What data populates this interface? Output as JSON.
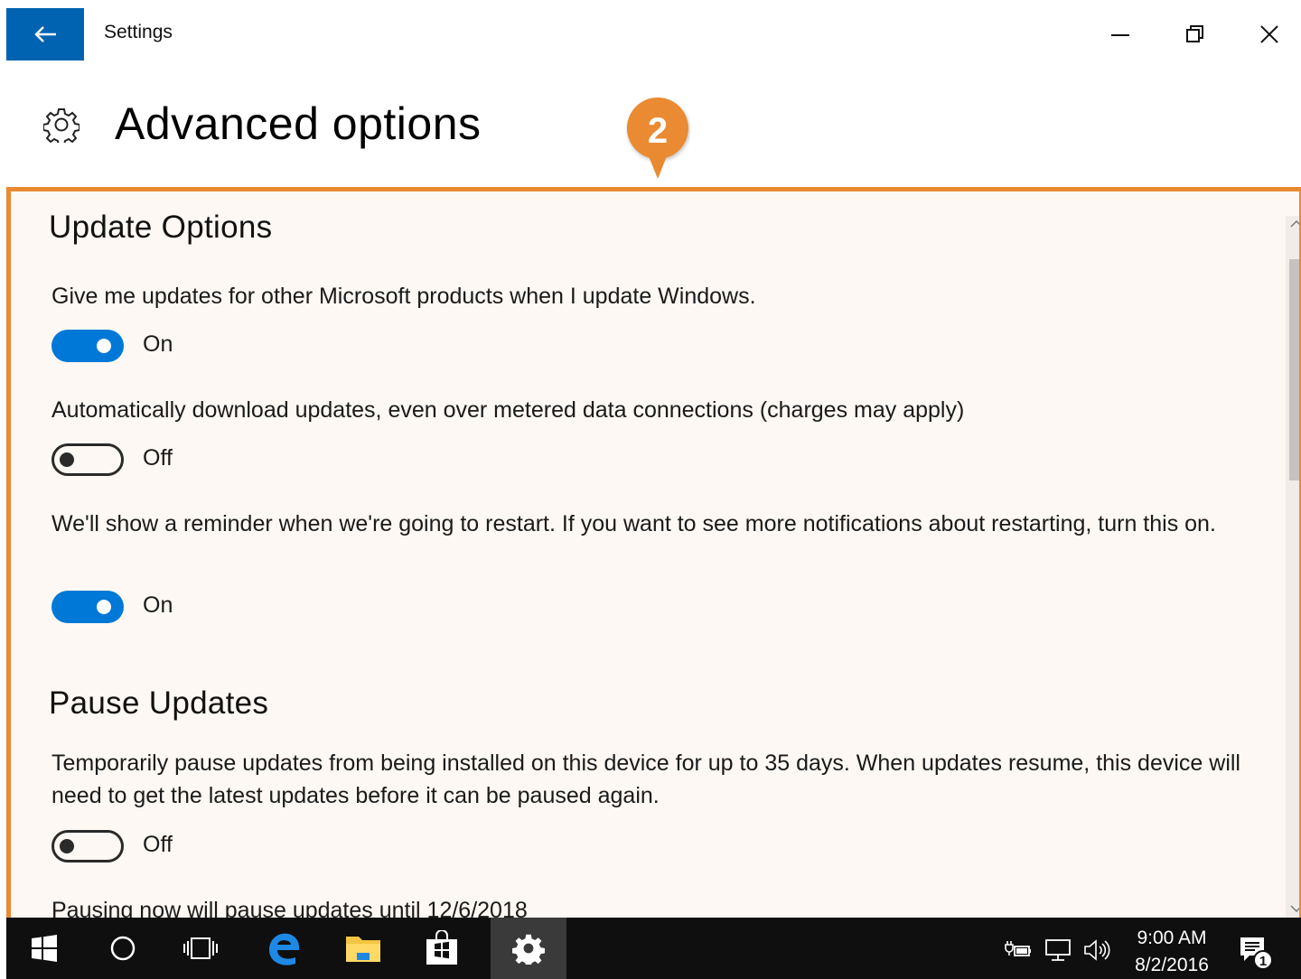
{
  "window": {
    "title": "Settings"
  },
  "header": {
    "title": "Advanced options",
    "callout_number": "2"
  },
  "colors": {
    "accent": "#0078d7",
    "back_button": "#0063b1",
    "highlight": "#ea8a30",
    "taskbar": "#0f0f0f"
  },
  "update_options": {
    "heading": "Update Options",
    "items": [
      {
        "description": "Give me updates for other Microsoft products when I update Windows.",
        "state": "On"
      },
      {
        "description": "Automatically download updates, even over metered data connections (charges may apply)",
        "state": "Off"
      },
      {
        "description": "We'll show a reminder when we're going to restart. If you want to see more notifications about restarting, turn this on.",
        "state": "On"
      }
    ]
  },
  "pause_updates": {
    "heading": "Pause Updates",
    "description": "Temporarily pause updates from being installed on this device for up to 35 days. When updates resume, this device will need to get the latest updates before it can be paused again.",
    "state": "Off",
    "footer": "Pausing now will pause updates until 12/6/2018"
  },
  "taskbar": {
    "icons": [
      "windows-start-icon",
      "cortana-search-icon",
      "task-view-icon",
      "edge-icon",
      "file-explorer-icon",
      "store-icon",
      "settings-gear-icon"
    ],
    "tray_icons": [
      "power-plug-icon",
      "network-icon",
      "volume-icon"
    ],
    "time": "9:00 AM",
    "date": "8/2/2016",
    "notification_count": "1"
  }
}
